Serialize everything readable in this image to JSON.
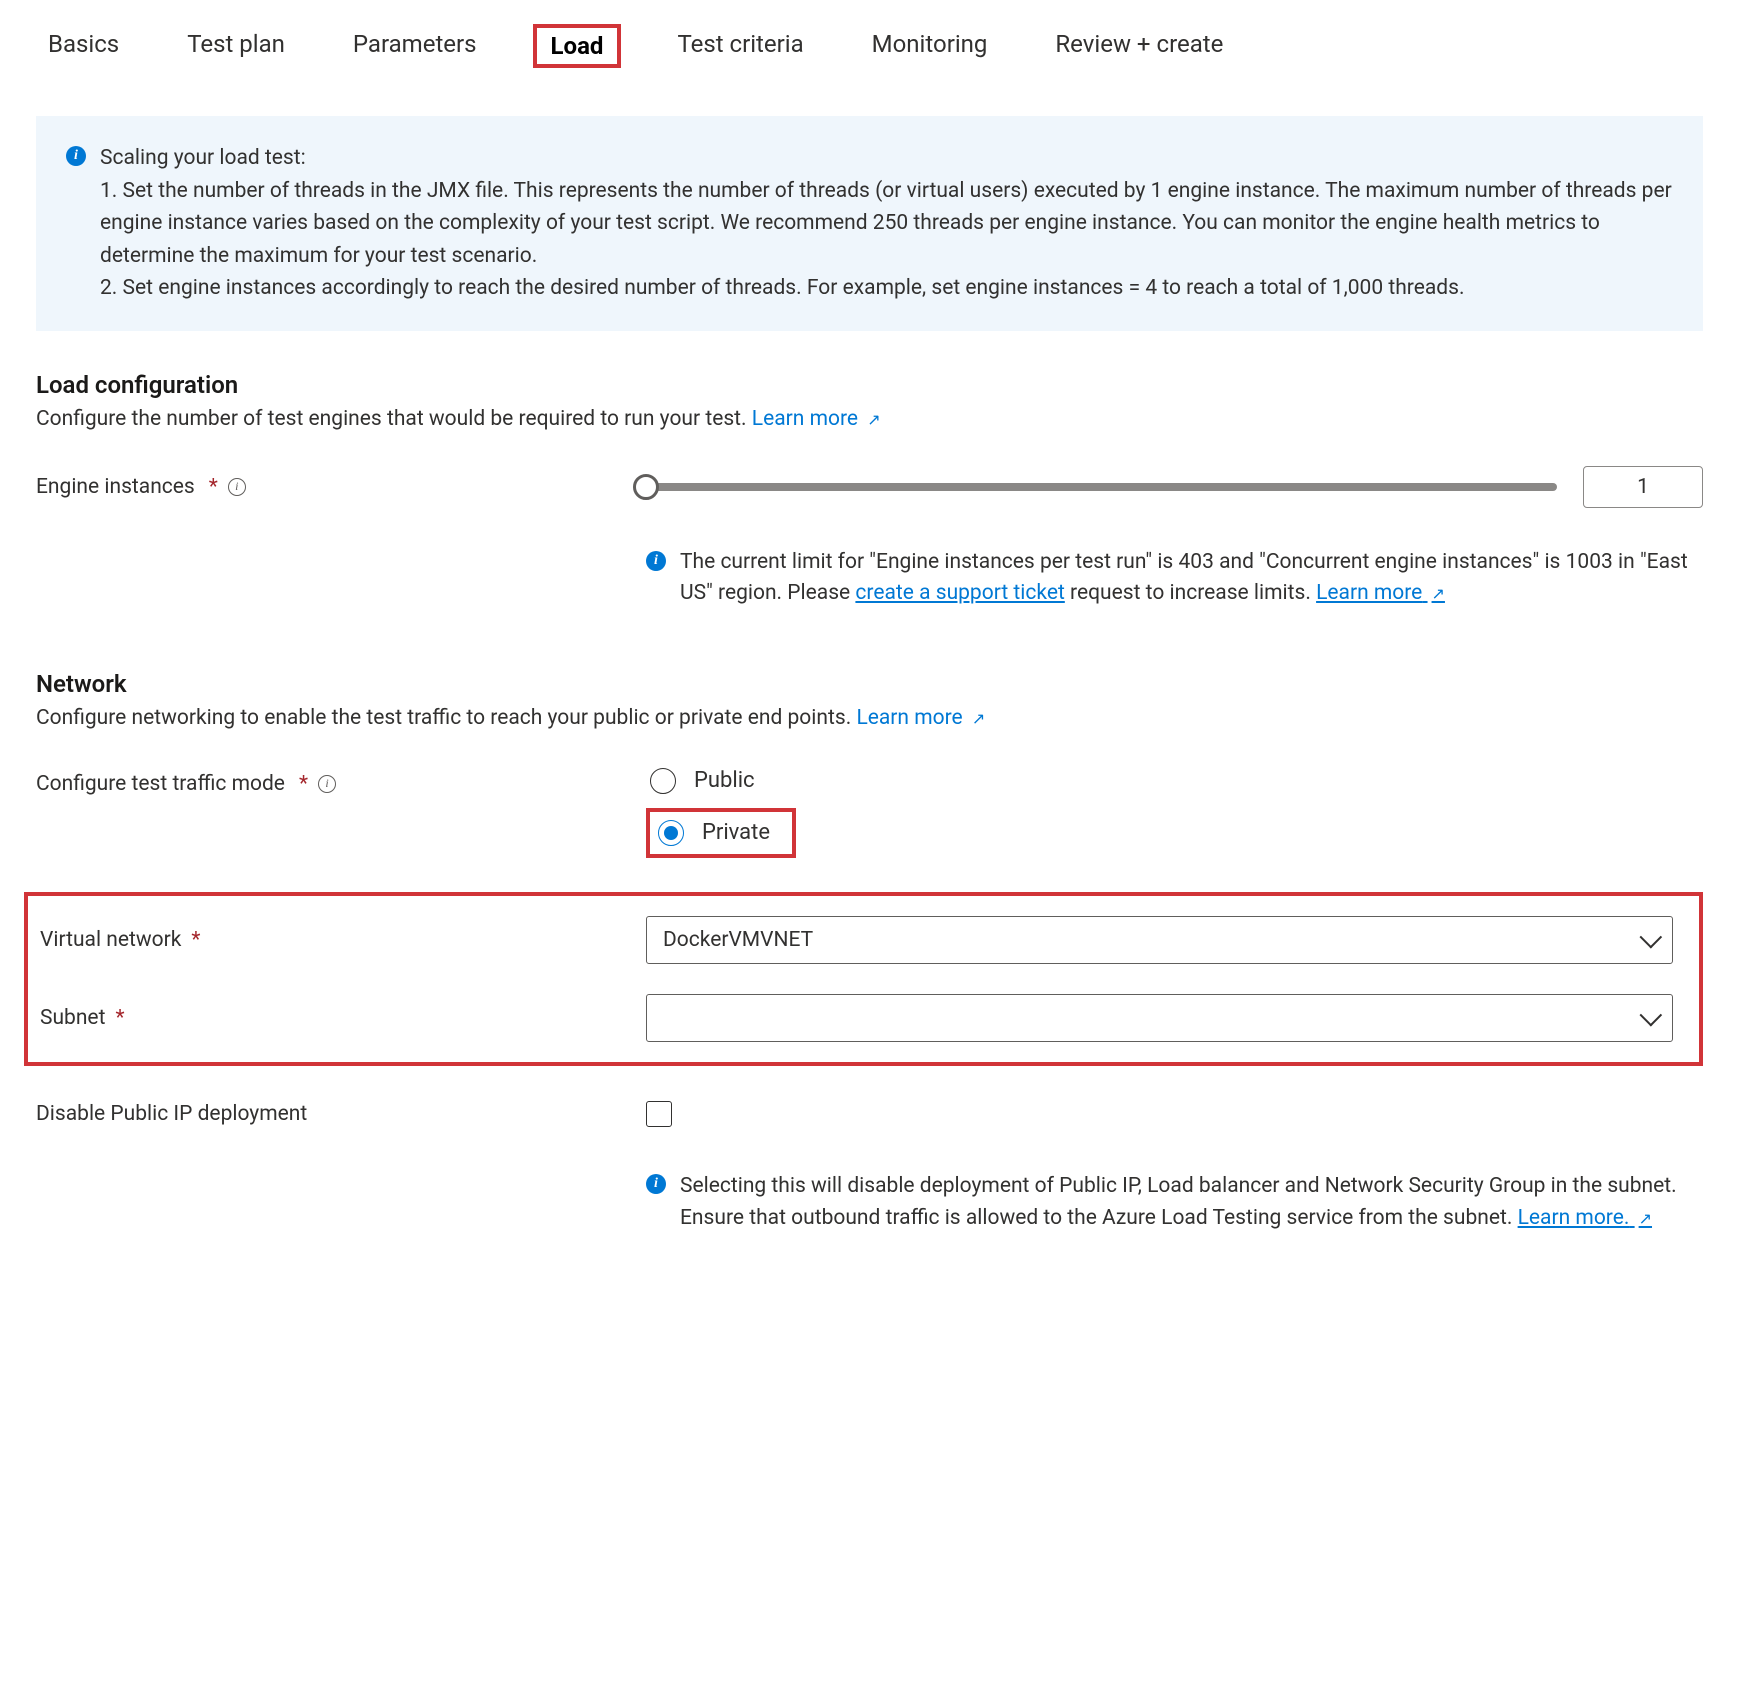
{
  "tabs": {
    "basics": "Basics",
    "test_plan": "Test plan",
    "parameters": "Parameters",
    "load": "Load",
    "test_criteria": "Test criteria",
    "monitoring": "Monitoring",
    "review_create": "Review + create"
  },
  "info_panel": {
    "heading": "Scaling your load test:",
    "line1": "1. Set the number of threads in the JMX file. This represents the number of threads (or virtual users) executed by 1 engine instance. The maximum number of threads per engine instance varies based on the complexity of your test script. We recommend 250 threads per engine instance. You can monitor the engine health metrics to determine the maximum for your test scenario.",
    "line2": "2. Set engine instances accordingly to reach the desired number of threads. For example, set engine instances = 4 to reach a total of 1,000 threads."
  },
  "load_config": {
    "title": "Load configuration",
    "desc": "Configure the number of test engines that would be required to run your test. ",
    "learn_more": "Learn more",
    "engine_label": "Engine instances",
    "engine_value": "1",
    "limit_part1": "The current limit for \"Engine instances per test run\" is 403 and \"Concurrent engine instances\" is 1003 in \"East US\" region. Please ",
    "support_link": "create a support ticket",
    "limit_part2": " request to increase limits. ",
    "learn_more2": "Learn more"
  },
  "network": {
    "title": "Network",
    "desc": "Configure networking to enable the test traffic to reach your public or private end points. ",
    "learn_more": "Learn more",
    "traffic_mode_label": "Configure test traffic mode",
    "option_public": "Public",
    "option_private": "Private",
    "vnet_label": "Virtual network",
    "vnet_value": "DockerVMVNET",
    "subnet_label": "Subnet",
    "subnet_value": "",
    "disable_ip_label": "Disable Public IP deployment",
    "disable_info": "Selecting this will disable deployment of Public IP, Load balancer and Network Security Group in the subnet. Ensure that outbound traffic is allowed to the Azure Load Testing service from the subnet. ",
    "disable_learn_more": "Learn more."
  }
}
